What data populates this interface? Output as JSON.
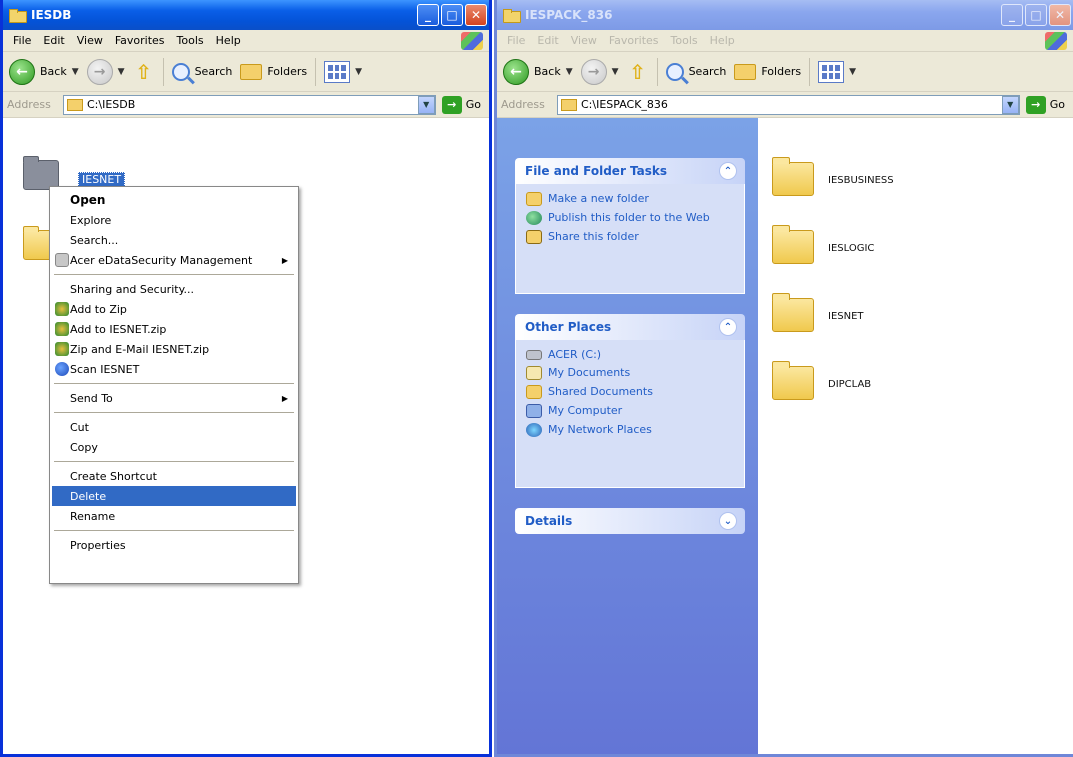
{
  "left_window": {
    "title": "IESDB",
    "menu": [
      "File",
      "Edit",
      "View",
      "Favorites",
      "Tools",
      "Help"
    ],
    "toolbar": {
      "back": "Back",
      "search": "Search",
      "folders": "Folders"
    },
    "address": {
      "label": "Address",
      "path": "C:\\IESDB",
      "go": "Go"
    },
    "selected_folder": "IESNET",
    "context_menu": [
      {
        "label": "Open",
        "bold": true
      },
      {
        "label": "Explore"
      },
      {
        "label": "Search..."
      },
      {
        "label": "Acer eDataSecurity Management",
        "submenu": true,
        "icon": "acer"
      },
      {
        "sep": true
      },
      {
        "label": "Sharing and Security..."
      },
      {
        "label": "Add to Zip",
        "icon": "zip"
      },
      {
        "label": "Add to IESNET.zip",
        "icon": "zip"
      },
      {
        "label": "Zip and E-Mail IESNET.zip",
        "icon": "zip"
      },
      {
        "label": "Scan IESNET",
        "icon": "scan"
      },
      {
        "sep": true
      },
      {
        "label": "Send To",
        "submenu": true
      },
      {
        "sep": true
      },
      {
        "label": "Cut"
      },
      {
        "label": "Copy"
      },
      {
        "sep": true
      },
      {
        "label": "Create Shortcut"
      },
      {
        "label": "Delete",
        "highlight": true
      },
      {
        "label": "Rename"
      },
      {
        "sep": true
      },
      {
        "label": "Properties"
      }
    ]
  },
  "right_window": {
    "title": "IESPACK_836",
    "menu": [
      "File",
      "Edit",
      "View",
      "Favorites",
      "Tools",
      "Help"
    ],
    "toolbar": {
      "back": "Back",
      "search": "Search",
      "folders": "Folders"
    },
    "address": {
      "label": "Address",
      "path": "C:\\IESPACK_836",
      "go": "Go"
    },
    "tasks": {
      "title": "File and Folder Tasks",
      "items": [
        "Make a new folder",
        "Publish this folder to the Web",
        "Share this folder"
      ]
    },
    "other_places": {
      "title": "Other Places",
      "items": [
        "ACER (C:)",
        "My Documents",
        "Shared Documents",
        "My Computer",
        "My Network Places"
      ]
    },
    "details": {
      "title": "Details"
    },
    "folders": [
      "IESBUSINESS",
      "IESLOGIC",
      "IESNET",
      "DIPCLAB"
    ]
  },
  "colors": {
    "xp_blue": "#0453d8",
    "highlight": "#316ac5",
    "task_link": "#215dc6"
  }
}
